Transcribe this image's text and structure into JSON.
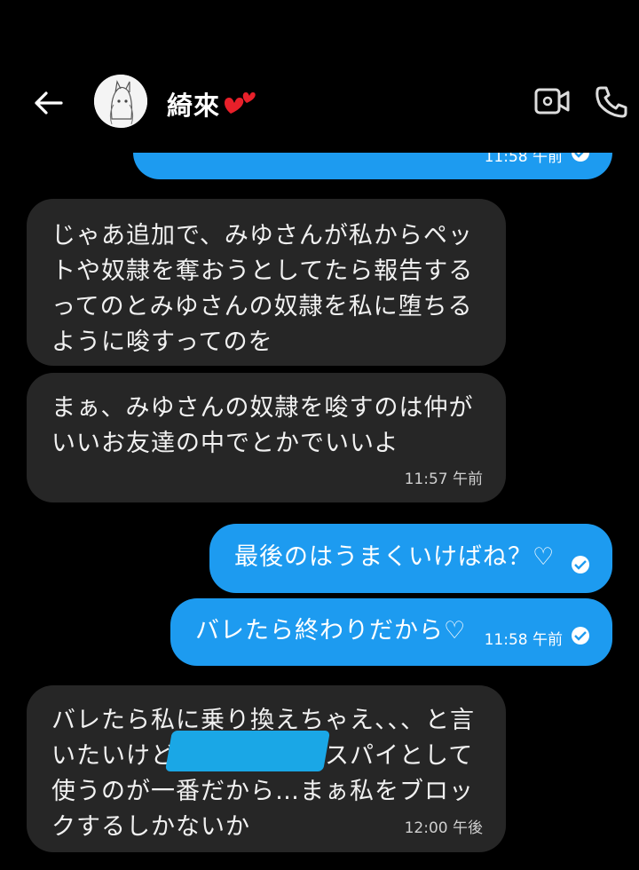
{
  "header": {
    "contact_name": "綺來",
    "hearts_icon_color": "#e8202a",
    "icons": [
      "back-arrow-icon",
      "video-call-icon",
      "phone-call-icon"
    ]
  },
  "colors": {
    "incoming_bubble": "#262626",
    "outgoing_bubble": "#1d9bf0",
    "background": "#000000"
  },
  "messages": [
    {
      "direction": "outgoing",
      "text": "",
      "time": "11:58 午前",
      "cut_off": true
    },
    {
      "direction": "incoming",
      "text": "じゃあ追加で、みゆさんが私からペッ\nトや奴隷を奪おうとしてたら報告する\nってのとみゆさんの奴隷を私に堕ちる\nように唆すってのを",
      "time": ""
    },
    {
      "direction": "incoming",
      "text": "まぁ、みゆさんの奴隷を唆すのは仲が\nいいお友達の中でとかでいいよ",
      "time": "11:57 午前"
    },
    {
      "direction": "outgoing",
      "text": "最後のはうまくいけばね？♡",
      "time": ""
    },
    {
      "direction": "outgoing",
      "text": "バレたら終わりだから♡",
      "time": "11:58 午前"
    },
    {
      "direction": "incoming",
      "text": "バレたら私に乗り換えちゃえ、、、と言\nいたいけど　　　　　　スパイとして\n使うのが一番だから…まぁ私をブロッ\nクするしかないか",
      "time": "12:00 午後",
      "redacted_part": true
    }
  ]
}
